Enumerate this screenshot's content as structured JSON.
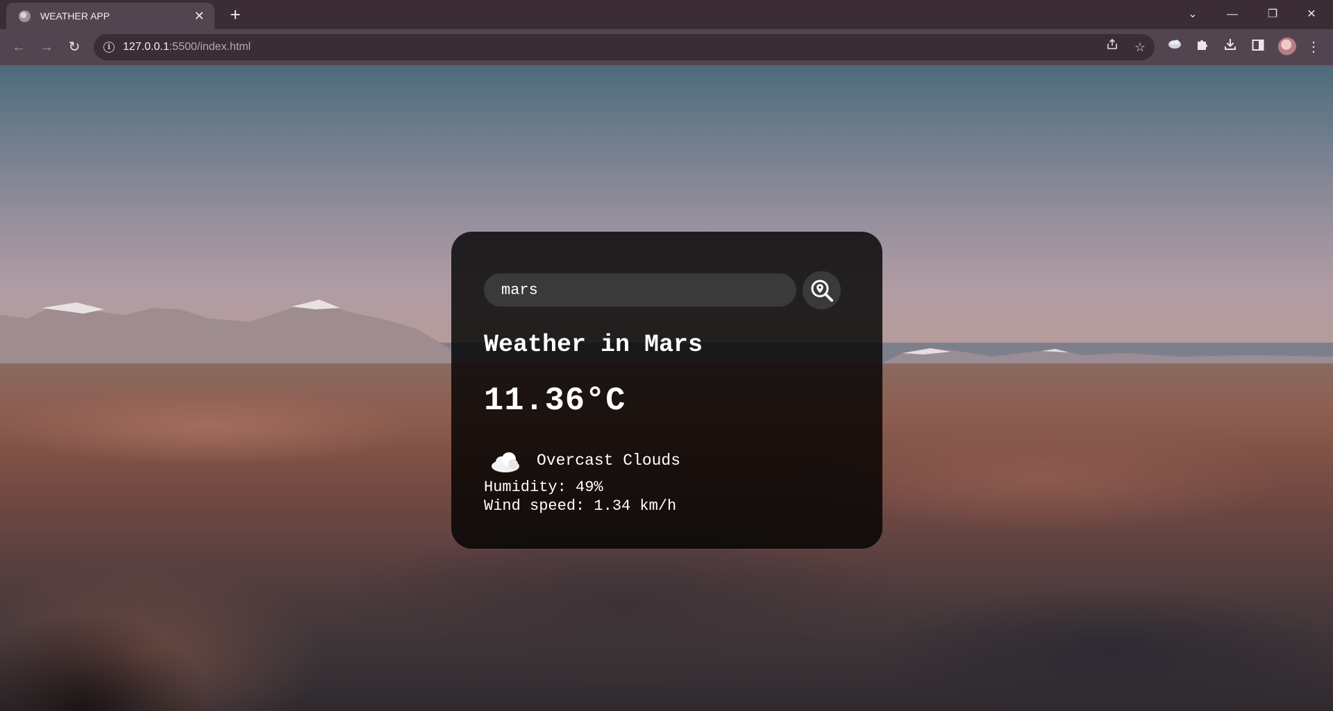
{
  "browser": {
    "tab_title": "WEATHER APP",
    "tab_close": "✕",
    "new_tab": "+",
    "url_host": "127.0.0.1",
    "url_rest": ":5500/index.html",
    "window_controls": {
      "dropdown": "⌄",
      "minimize": "—",
      "restore": "❐",
      "close": "✕"
    },
    "nav": {
      "back": "←",
      "forward": "→",
      "reload": "↻"
    },
    "toolbar_icons": [
      "share-icon",
      "bookmark-star-icon",
      "extension-icon",
      "puzzle-icon",
      "download-icon",
      "side-panel-icon",
      "profile-avatar",
      "menu-icon"
    ]
  },
  "weather": {
    "search_value": "mars",
    "search_placeholder": "Search",
    "city_heading": "Weather in Mars",
    "temperature": "11.36°C",
    "description": "Overcast Clouds",
    "humidity": "Humidity: 49%",
    "wind": "Wind speed: 1.34 km/h"
  },
  "colors": {
    "card_background": "rgba(0,0,0,0.8)",
    "input_background": "#3a3a3a",
    "text": "#ffffff",
    "chrome_dark": "#3b2c35",
    "chrome_light": "#534550"
  }
}
